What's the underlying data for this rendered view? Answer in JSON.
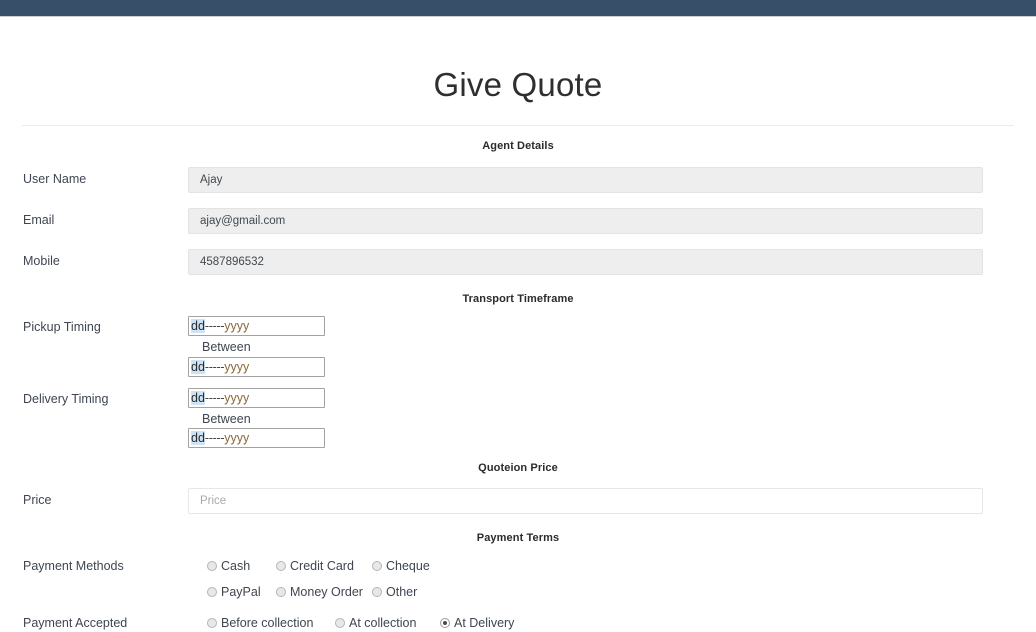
{
  "nav": {
    "bar_color": "#374f68"
  },
  "header": {
    "title": "Give Quote"
  },
  "sections": {
    "agent": {
      "heading": "Agent Details",
      "fields": [
        {
          "label": "User Name",
          "value": "Ajay"
        },
        {
          "label": "Email",
          "value": "ajay@gmail.com"
        },
        {
          "label": "Mobile",
          "value": "4587896532"
        }
      ]
    },
    "transport": {
      "heading": "Transport Timeframe",
      "between_label": "Between",
      "date_placeholder": {
        "day": "dd",
        "sep": "-----",
        "year": "yyyy"
      },
      "rows": [
        {
          "label": "Pickup Timing"
        },
        {
          "label": "Delivery Timing"
        }
      ]
    },
    "quotation": {
      "heading": "Quoteion Price",
      "price_label": "Price",
      "price_value": "",
      "price_placeholder": "Price"
    },
    "payment": {
      "heading": "Payment Terms",
      "methods_label": "Payment Methods",
      "methods_row1": [
        {
          "label": "Cash",
          "selected": false
        },
        {
          "label": "Credit Card",
          "selected": false
        },
        {
          "label": "Cheque",
          "selected": false
        }
      ],
      "methods_row2": [
        {
          "label": "PayPal",
          "selected": false
        },
        {
          "label": "Money Order",
          "selected": false
        },
        {
          "label": "Other",
          "selected": false
        }
      ],
      "accepted_label": "Payment Accepted",
      "accepted_options": [
        {
          "label": "Before collection",
          "selected": false
        },
        {
          "label": "At collection",
          "selected": false
        },
        {
          "label": "At Delivery",
          "selected": true
        }
      ]
    }
  }
}
